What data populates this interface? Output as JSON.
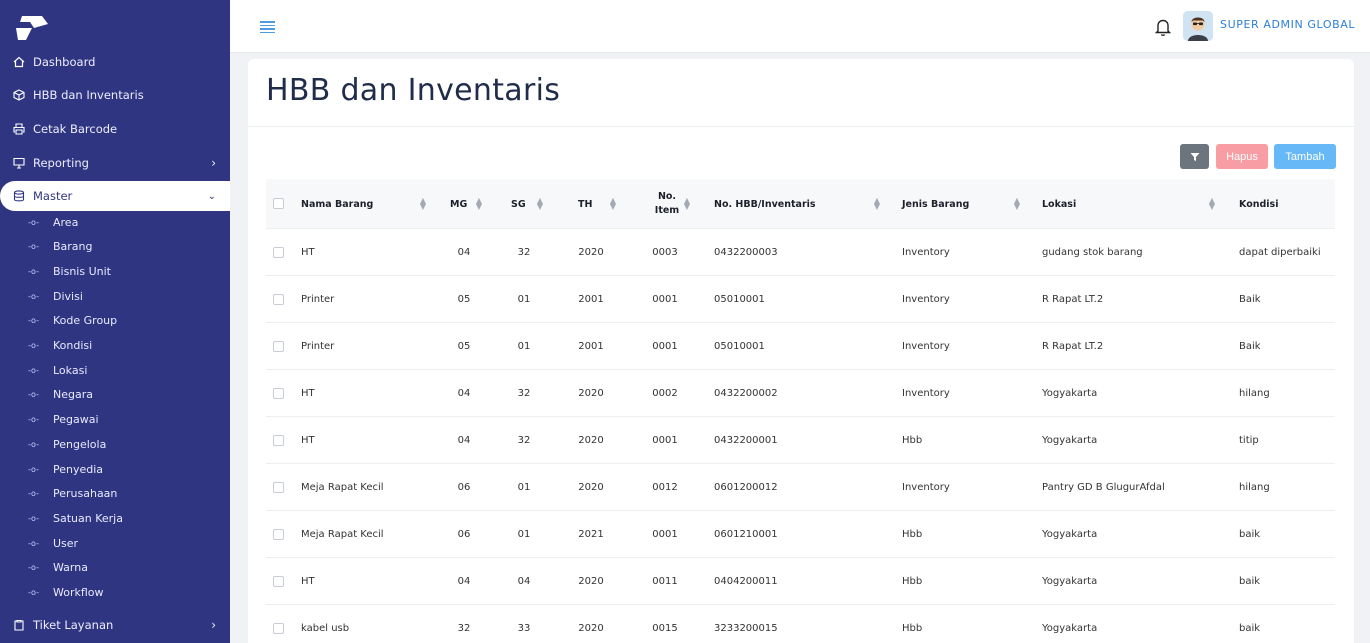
{
  "sidebar": {
    "nav": [
      {
        "label": "Dashboard",
        "icon": "home-icon"
      },
      {
        "label": "HBB dan Inventaris",
        "icon": "box-icon"
      },
      {
        "label": "Cetak Barcode",
        "icon": "printer-icon"
      },
      {
        "label": "Reporting",
        "icon": "monitor-icon"
      },
      {
        "label": "Master",
        "icon": "database-icon"
      }
    ],
    "master_items": [
      "Area",
      "Barang",
      "Bisnis Unit",
      "Divisi",
      "Kode Group",
      "Kondisi",
      "Lokasi",
      "Negara",
      "Pegawai",
      "Pengelola",
      "Penyedia",
      "Perusahaan",
      "Satuan Kerja",
      "User",
      "Warna",
      "Workflow"
    ],
    "tiket": {
      "label": "Tiket Layanan",
      "icon": "clipboard-icon"
    }
  },
  "header": {
    "user_name": "SUPER ADMIN GLOBAL"
  },
  "page": {
    "title": "HBB dan Inventaris",
    "buttons": {
      "hapus": "Hapus",
      "tambah": "Tambah"
    }
  },
  "table": {
    "headers": {
      "nama_barang": "Nama Barang",
      "mg": "MG",
      "sg": "SG",
      "th": "TH",
      "no_item_1": "No.",
      "no_item_2": "Item",
      "no_hbb": "No. HBB/Inventaris",
      "jenis": "Jenis Barang",
      "lokasi": "Lokasi",
      "kondisi": "Kondisi"
    },
    "rows": [
      {
        "nama": "HT",
        "mg": "04",
        "sg": "32",
        "th": "2020",
        "item": "0003",
        "hbb": "0432200003",
        "jenis": "Inventory",
        "lokasi": "gudang stok barang",
        "kondisi": "dapat diperbaiki"
      },
      {
        "nama": "Printer",
        "mg": "05",
        "sg": "01",
        "th": "2001",
        "item": "0001",
        "hbb": "05010001",
        "jenis": "Inventory",
        "lokasi": "R Rapat LT.2",
        "kondisi": "Baik"
      },
      {
        "nama": "Printer",
        "mg": "05",
        "sg": "01",
        "th": "2001",
        "item": "0001",
        "hbb": "05010001",
        "jenis": "Inventory",
        "lokasi": "R Rapat LT.2",
        "kondisi": "Baik"
      },
      {
        "nama": "HT",
        "mg": "04",
        "sg": "32",
        "th": "2020",
        "item": "0002",
        "hbb": "0432200002",
        "jenis": "Inventory",
        "lokasi": "Yogyakarta",
        "kondisi": "hilang"
      },
      {
        "nama": "HT",
        "mg": "04",
        "sg": "32",
        "th": "2020",
        "item": "0001",
        "hbb": "0432200001",
        "jenis": "Hbb",
        "lokasi": "Yogyakarta",
        "kondisi": "titip"
      },
      {
        "nama": "Meja Rapat Kecil",
        "mg": "06",
        "sg": "01",
        "th": "2020",
        "item": "0012",
        "hbb": "0601200012",
        "jenis": "Inventory",
        "lokasi": "Pantry GD B GlugurAfdal",
        "kondisi": "hilang"
      },
      {
        "nama": "Meja Rapat Kecil",
        "mg": "06",
        "sg": "01",
        "th": "2021",
        "item": "0001",
        "hbb": "0601210001",
        "jenis": "Hbb",
        "lokasi": "Yogyakarta",
        "kondisi": "baik"
      },
      {
        "nama": "HT",
        "mg": "04",
        "sg": "04",
        "th": "2020",
        "item": "0011",
        "hbb": "0404200011",
        "jenis": "Hbb",
        "lokasi": "Yogyakarta",
        "kondisi": "baik"
      },
      {
        "nama": "kabel usb",
        "mg": "32",
        "sg": "33",
        "th": "2020",
        "item": "0015",
        "hbb": "3233200015",
        "jenis": "Hbb",
        "lokasi": "Yogyakarta",
        "kondisi": "baik"
      }
    ]
  }
}
